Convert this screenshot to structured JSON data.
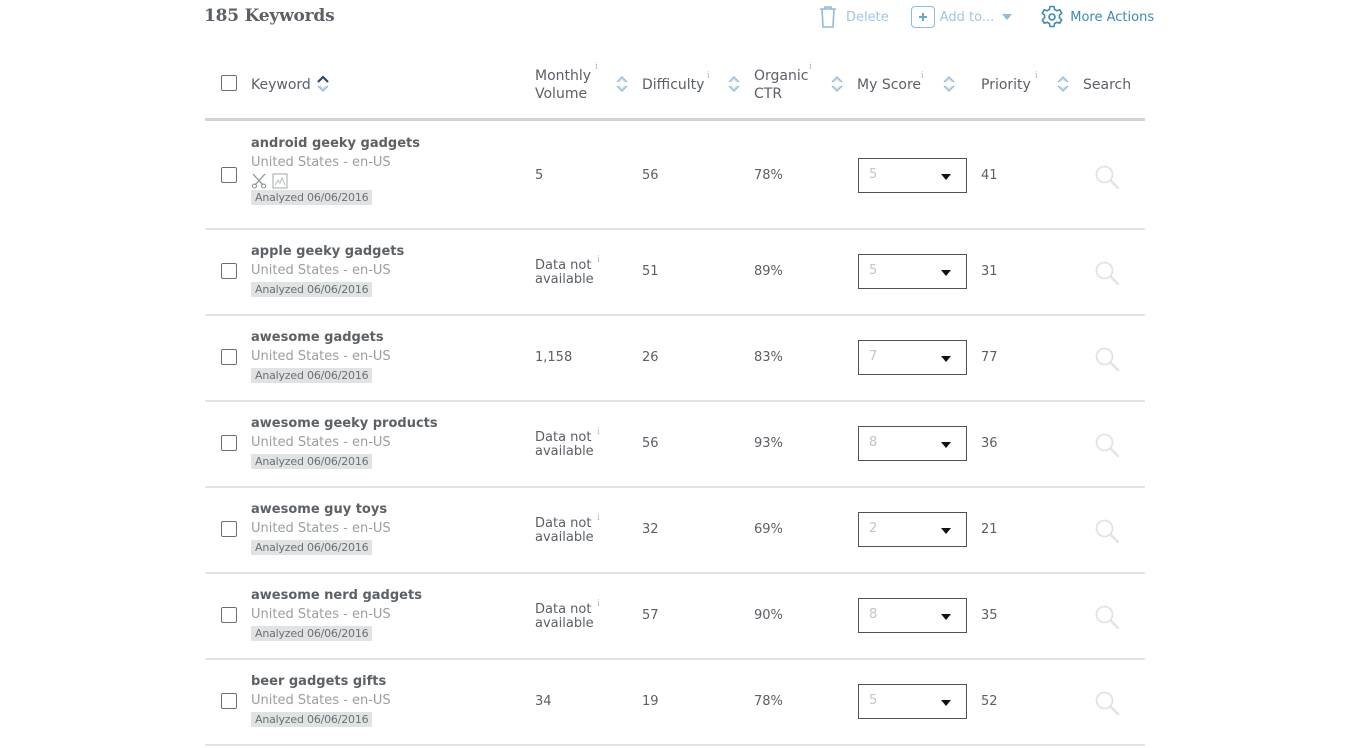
{
  "header": {
    "title": "185 Keywords"
  },
  "toolbar": {
    "delete_label": "Delete",
    "add_label": "Add to...",
    "more_label": "More Actions",
    "accent_color": "#3d89b8",
    "disabled_color": "#9fc7de"
  },
  "table": {
    "columns": {
      "keyword": "Keyword",
      "volume_line1": "Monthly",
      "volume_line2": "Volume",
      "difficulty": "Difficulty",
      "ctr_line1": "Organic",
      "ctr_line2": "CTR",
      "myscore": "My Score",
      "priority": "Priority",
      "search": "Search",
      "info_glyph": "i"
    },
    "na_line1": "Data not",
    "na_line2": "available",
    "rows": [
      {
        "keyword": "android geeky gadgets",
        "locale": "United States - en-US",
        "analyzed": "Analyzed 06/06/2016",
        "volume": "5",
        "difficulty": "56",
        "ctr": "78%",
        "my_score": "5",
        "priority": "41",
        "has_feature_icons": true
      },
      {
        "keyword": "apple geeky gadgets",
        "locale": "United States - en-US",
        "analyzed": "Analyzed 06/06/2016",
        "volume": null,
        "difficulty": "51",
        "ctr": "89%",
        "my_score": "5",
        "priority": "31"
      },
      {
        "keyword": "awesome gadgets",
        "locale": "United States - en-US",
        "analyzed": "Analyzed 06/06/2016",
        "volume": "1,158",
        "difficulty": "26",
        "ctr": "83%",
        "my_score": "7",
        "priority": "77"
      },
      {
        "keyword": "awesome geeky products",
        "locale": "United States - en-US",
        "analyzed": "Analyzed 06/06/2016",
        "volume": null,
        "difficulty": "56",
        "ctr": "93%",
        "my_score": "8",
        "priority": "36"
      },
      {
        "keyword": "awesome guy toys",
        "locale": "United States - en-US",
        "analyzed": "Analyzed 06/06/2016",
        "volume": null,
        "difficulty": "32",
        "ctr": "69%",
        "my_score": "2",
        "priority": "21"
      },
      {
        "keyword": "awesome nerd gadgets",
        "locale": "United States - en-US",
        "analyzed": "Analyzed 06/06/2016",
        "volume": null,
        "difficulty": "57",
        "ctr": "90%",
        "my_score": "8",
        "priority": "35"
      },
      {
        "keyword": "beer gadgets gifts",
        "locale": "United States - en-US",
        "analyzed": "Analyzed 06/06/2016",
        "volume": "34",
        "difficulty": "19",
        "ctr": "78%",
        "my_score": "5",
        "priority": "52"
      }
    ]
  }
}
